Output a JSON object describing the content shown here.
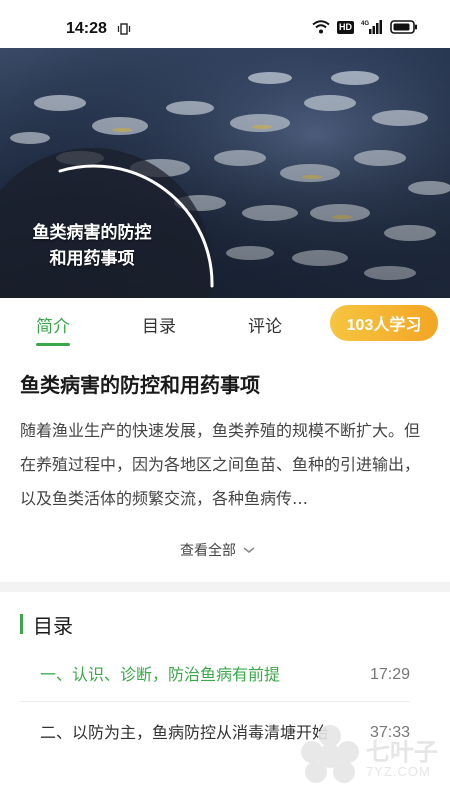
{
  "status_bar": {
    "time": "14:28",
    "icons": [
      "vibrate-icon",
      "wifi-icon",
      "hd-icon",
      "signal-4g-icon",
      "battery-icon"
    ],
    "hd_label": "HD",
    "network_label": "4G"
  },
  "hero": {
    "title_line1": "鱼类病害的防控",
    "title_line2": "和用药事项"
  },
  "tabs": [
    {
      "label": "简介",
      "active": true
    },
    {
      "label": "目录",
      "active": false
    },
    {
      "label": "评论",
      "active": false
    }
  ],
  "learners_badge": "103人学习",
  "intro": {
    "title": "鱼类病害的防控和用药事项",
    "body": "随着渔业生产的快速发展，鱼类养殖的规模不断扩大。但在养殖过程中，因为各地区之间鱼苗、鱼种的引进输出，以及鱼类活体的频繁交流，各种鱼病传…",
    "view_all": "查看全部"
  },
  "catalog": {
    "heading": "目录",
    "lessons": [
      {
        "title": "一、认识、诊断，防治鱼病有前提",
        "time": "17:29",
        "active": true
      },
      {
        "title": "二、以防为主，鱼病防控从消毒清塘开始",
        "time": "37:33",
        "active": false
      }
    ]
  },
  "watermark": {
    "brand": "七叶子",
    "domain": "7YZ.COM"
  },
  "colors": {
    "accent_green": "#3aa84a",
    "badge_orange": "#f3a524"
  }
}
